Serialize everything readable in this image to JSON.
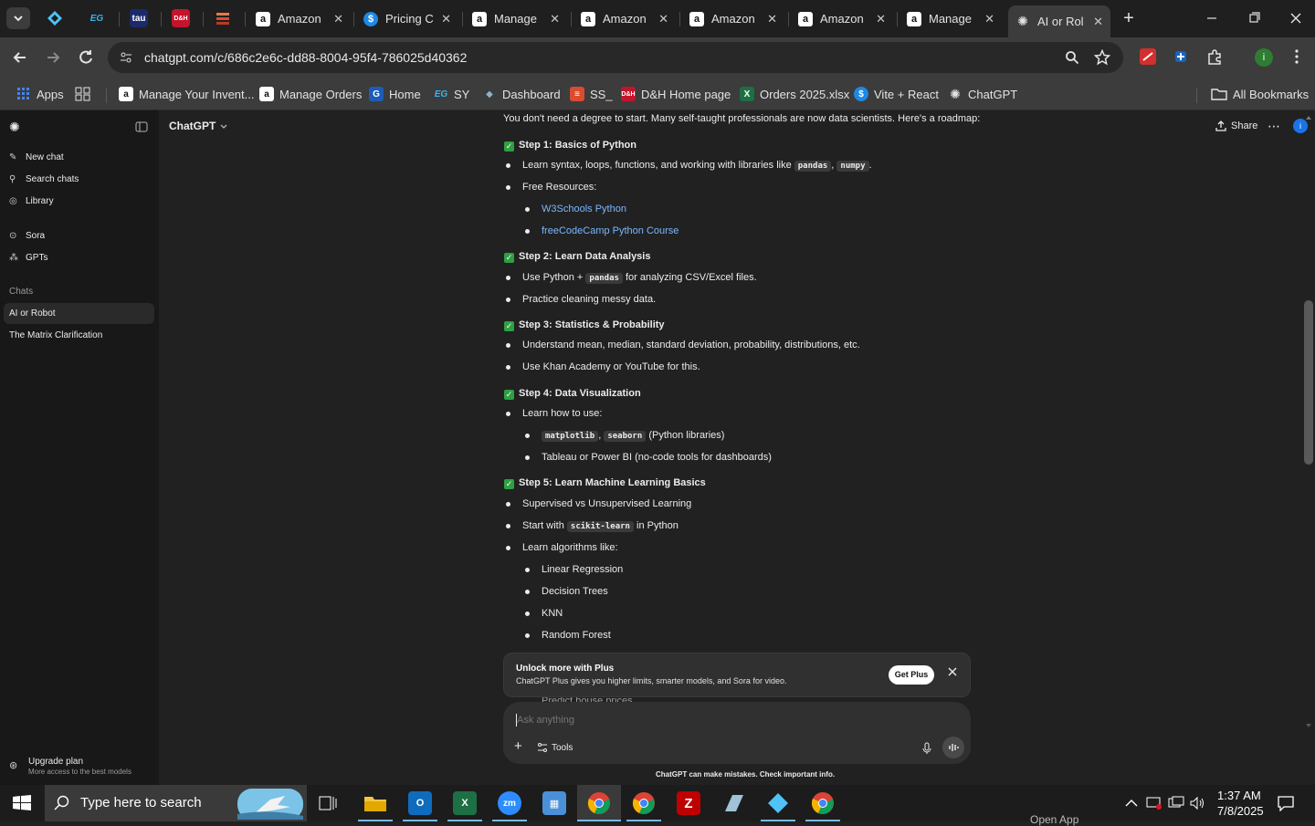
{
  "browser": {
    "tabs": [
      {
        "title": "Amazon",
        "icon": "amazon-icon"
      },
      {
        "title": "Pricing C",
        "icon": "dollar-icon"
      },
      {
        "title": "Manage",
        "icon": "amazon-icon"
      },
      {
        "title": "Amazon",
        "icon": "amazon-icon"
      },
      {
        "title": "Amazon",
        "icon": "amazon-icon"
      },
      {
        "title": "Amazon",
        "icon": "amazon-icon"
      },
      {
        "title": "Manage",
        "icon": "amazon-icon"
      },
      {
        "title": "AI or Rol",
        "icon": "chatgpt-icon"
      }
    ],
    "pinned_tabs": [
      "EG",
      "tau"
    ],
    "url": "chatgpt.com/c/686c2e6c-dd88-8004-95f4-786025d40362",
    "bookmarks": [
      {
        "label": "Apps",
        "icon": "apps-grid-icon"
      },
      {
        "label": "Manage Your Invent...",
        "icon": "amazon-icon"
      },
      {
        "label": "Manage Orders",
        "icon": "amazon-icon"
      },
      {
        "label": "Home",
        "icon": "home-icon"
      },
      {
        "label": "SY",
        "icon": "eg-icon"
      },
      {
        "label": "Dashboard",
        "icon": "dashboard-icon"
      },
      {
        "label": "SS_",
        "icon": "stack-icon"
      },
      {
        "label": "D&H Home page",
        "icon": "dh-icon"
      },
      {
        "label": "Orders 2025.xlsx",
        "icon": "excel-icon"
      },
      {
        "label": "Vite + React",
        "icon": "vite-icon"
      },
      {
        "label": "ChatGPT",
        "icon": "chatgpt-icon"
      }
    ],
    "all_bookmarks": "All Bookmarks"
  },
  "sidebar": {
    "top_items": [
      {
        "label": "New chat",
        "icon": "edit-icon"
      },
      {
        "label": "Search chats",
        "icon": "search-icon"
      },
      {
        "label": "Library",
        "icon": "library-icon"
      }
    ],
    "mid_items": [
      {
        "label": "Sora",
        "icon": "play-circle-icon"
      },
      {
        "label": "GPTs",
        "icon": "grid-icon"
      }
    ],
    "chats_heading": "Chats",
    "chats": [
      {
        "label": "AI or Robot",
        "active": true
      },
      {
        "label": "The Matrix Clarification",
        "active": false
      }
    ],
    "upgrade": {
      "title": "Upgrade plan",
      "subtitle": "More access to the best models"
    }
  },
  "header": {
    "model": "ChatGPT",
    "share": "Share"
  },
  "content": {
    "intro": "You don't need a degree to start. Many self-taught professionals are now data scientists. Here's a roadmap:",
    "step1": "Step 1: Basics of Python",
    "s1_b1_pre": "Learn syntax, loops, functions, and working with libraries like",
    "s1_b1_code1": "pandas",
    "s1_b1_code2": "numpy",
    "s1_b2": "Free Resources:",
    "s1_link1": "W3Schools Python",
    "s1_link2": "freeCodeCamp Python Course",
    "step2": "Step 2: Learn Data Analysis",
    "s2_b1_pre": "Use Python +",
    "s2_b1_code": "pandas",
    "s2_b1_post": "for analyzing CSV/Excel files.",
    "s2_b2": "Practice cleaning messy data.",
    "step3": "Step 3: Statistics & Probability",
    "s3_b1": "Understand mean, median, standard deviation, probability, distributions, etc.",
    "s3_b2": "Use Khan Academy or YouTube for this.",
    "step4": "Step 4: Data Visualization",
    "s4_b1": "Learn how to use:",
    "s4_sub1_code1": "matplotlib",
    "s4_sub1_code2": "seaborn",
    "s4_sub1_post": "(Python libraries)",
    "s4_sub2": "Tableau or Power BI (no-code tools for dashboards)",
    "step5": "Step 5: Learn Machine Learning Basics",
    "s5_b1": "Supervised vs Unsupervised Learning",
    "s5_b2_pre": "Start with",
    "s5_b2_code": "scikit-learn",
    "s5_b2_post": "in Python",
    "s5_b3": "Learn algorithms like:",
    "s5_algos": [
      "Linear Regression",
      "Decision Trees",
      "KNN",
      "Random Forest"
    ],
    "partial": "Predict house prices"
  },
  "banner": {
    "title": "Unlock more with Plus",
    "subtitle": "ChatGPT Plus gives you higher limits, smarter models, and Sora for video.",
    "button": "Get Plus"
  },
  "composer": {
    "placeholder": "Ask anything",
    "tools": "Tools"
  },
  "disclaimer": "ChatGPT can make mistakes. Check important info.",
  "taskbar": {
    "search_placeholder": "Type here to search",
    "time": "1:37 AM",
    "date": "7/8/2025",
    "open_app": "Open App"
  }
}
